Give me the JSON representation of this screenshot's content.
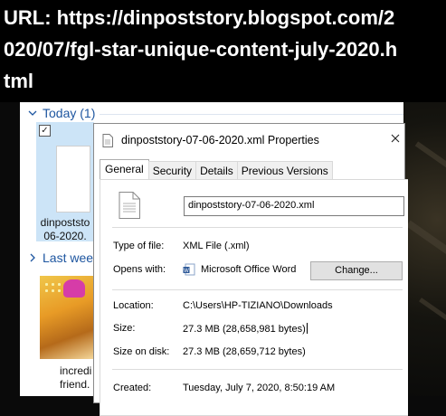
{
  "banner": {
    "line1": "URL: https://dinpoststory.blogspot.com/2",
    "line2": "020/07/fgl-star-unique-content-july-2020.h",
    "line3": "tml"
  },
  "explorer": {
    "groups": [
      {
        "label": "Today (1)"
      },
      {
        "label": "Last wee"
      }
    ],
    "files": [
      {
        "name_line1": "dinpoststo",
        "name_line2": "06-2020."
      }
    ],
    "images": [
      {
        "name_line1": "incredi",
        "name_line2": "friend."
      }
    ]
  },
  "dialog": {
    "title": "dinpoststory-07-06-2020.xml Properties",
    "tabs": [
      "General",
      "Security",
      "Details",
      "Previous Versions"
    ],
    "file_name": "dinpoststory-07-06-2020.xml",
    "rows": {
      "type_label": "Type of file:",
      "type_value": "XML File (.xml)",
      "opens_label": "Opens with:",
      "opens_value": "Microsoft Office Word",
      "change_label": "Change...",
      "location_label": "Location:",
      "location_value": "C:\\Users\\HP-TIZIANO\\Downloads",
      "size_label": "Size:",
      "size_value": "27.3 MB (28,658,981 bytes)",
      "size_disk_label": "Size on disk:",
      "size_disk_value": "27.3 MB (28,659,712 bytes)",
      "created_label": "Created:",
      "created_value": "Tuesday, July 7, 2020, 8:50:19 AM"
    }
  },
  "icons": {
    "chevron": "chevron-down-icon",
    "document": "document-icon",
    "close": "close-icon",
    "word": "word-icon"
  },
  "colors": {
    "group_header": "#1e56a0",
    "selected_tile": "#cce4f7"
  }
}
